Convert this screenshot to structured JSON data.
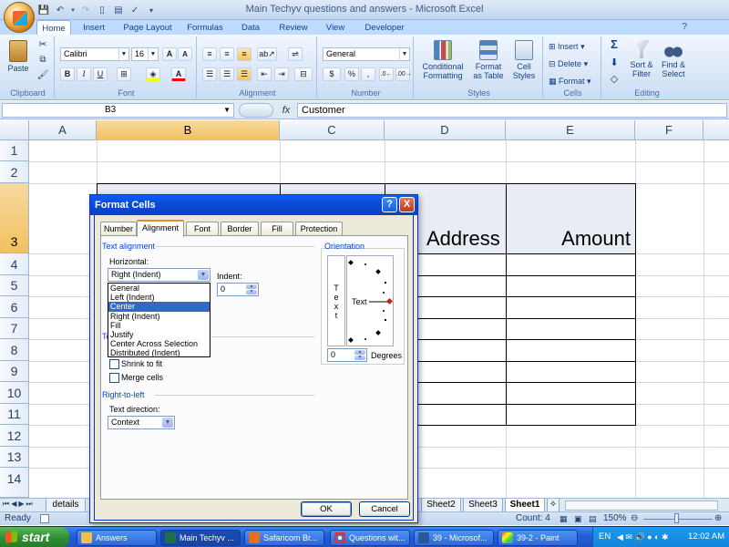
{
  "window": {
    "title": "Main Techyv questions and answers - Microsoft Excel"
  },
  "ribbon": {
    "tabs": [
      "Home",
      "Insert",
      "Page Layout",
      "Formulas",
      "Data",
      "Review",
      "View",
      "Developer"
    ],
    "active_tab": "Home",
    "clipboard": {
      "label": "Clipboard",
      "paste": "Paste"
    },
    "font": {
      "label": "Font",
      "name": "Calibri",
      "size": "16",
      "bold": "B",
      "italic": "I",
      "underline": "U"
    },
    "alignment": {
      "label": "Alignment"
    },
    "number": {
      "label": "Number",
      "format": "General",
      "currency": "$",
      "percent": "%",
      "comma": ","
    },
    "styles": {
      "label": "Styles",
      "conditional": [
        "Conditional",
        "Formatting"
      ],
      "format_table": [
        "Format",
        "as Table"
      ],
      "cell_styles": [
        "Cell",
        "Styles"
      ]
    },
    "cells": {
      "label": "Cells",
      "insert": "Insert",
      "delete": "Delete",
      "format": "Format"
    },
    "editing": {
      "label": "Editing",
      "sigma": "Σ",
      "sort": [
        "Sort &",
        "Filter"
      ],
      "find": [
        "Find &",
        "Select"
      ]
    }
  },
  "formula_bar": {
    "name_box": "B3",
    "fx": "fx",
    "content": "Customer"
  },
  "sheet": {
    "columns": [
      "A",
      "B",
      "C",
      "D",
      "E",
      "F"
    ],
    "rows": [
      "1",
      "2",
      "3",
      "4",
      "5",
      "6",
      "7",
      "8",
      "9",
      "10",
      "11",
      "12",
      "13",
      "14"
    ],
    "selected_column": "B",
    "selected_row": "3",
    "cells": {
      "D3": "Address",
      "E3": "Amount"
    }
  },
  "sheet_tabs": {
    "tabs": [
      "details",
      "Sheet2",
      "Sheet3",
      "Sheet1"
    ],
    "active": "Sheet1"
  },
  "status_bar": {
    "mode": "Ready",
    "count": "Count: 4",
    "zoom": "150%"
  },
  "dialog": {
    "title": "Format Cells",
    "help": "?",
    "close": "X",
    "tabs": [
      "Number",
      "Alignment",
      "Font",
      "Border",
      "Fill",
      "Protection"
    ],
    "active_tab": "Alignment",
    "text_alignment": "Text alignment",
    "horizontal_label": "Horizontal:",
    "horizontal_value": "Right (Indent)",
    "horizontal_options": [
      "General",
      "Left (Indent)",
      "Center",
      "Right (Indent)",
      "Fill",
      "Justify",
      "Center Across Selection",
      "Distributed (Indent)"
    ],
    "horizontal_selected": "Center",
    "indent_label": "Indent:",
    "indent_value": "0",
    "text_control_partial": "Te",
    "shrink_to_fit": "Shrink to fit",
    "merge_cells": "Merge cells",
    "right_to_left": "Right-to-left",
    "text_direction_label": "Text direction:",
    "text_direction_value": "Context",
    "orientation": "Orientation",
    "vertical_text": [
      "T",
      "e",
      "x",
      "t"
    ],
    "orient_text": "Text",
    "degrees_value": "0",
    "degrees_label": "Degrees",
    "ok": "OK",
    "cancel": "Cancel"
  },
  "taskbar": {
    "start": "start",
    "tasks": [
      "Answers",
      "Main Techyv ...",
      "Safaricom Br...",
      "Questions wit...",
      "39 - Microsof...",
      "39-2 - Paint"
    ],
    "lang": "EN",
    "clock": "12:02 AM"
  }
}
